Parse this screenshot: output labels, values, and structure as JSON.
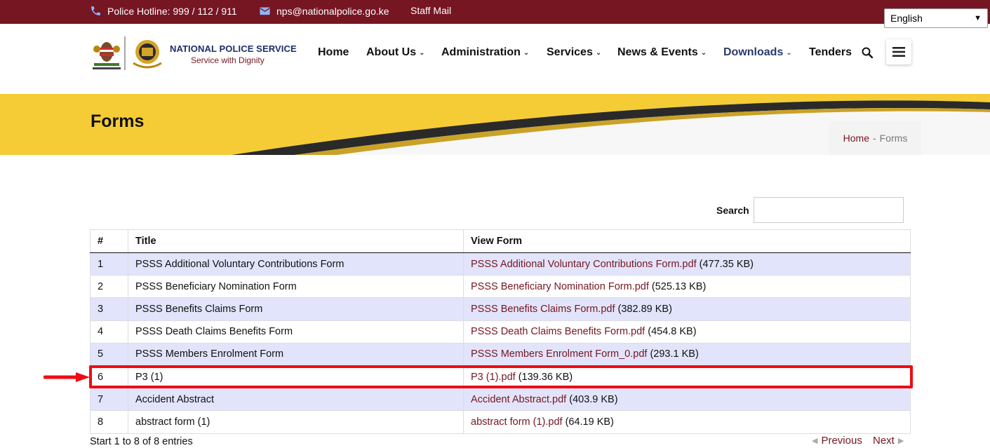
{
  "topbar": {
    "hotline": "Police Hotline: 999 / 112 / 911",
    "email": "nps@nationalpolice.go.ke",
    "staff_mail": "Staff Mail",
    "language": "English"
  },
  "logo": {
    "brand": "NATIONAL POLICE SERVICE",
    "tagline": "Service with Dignity"
  },
  "nav": [
    {
      "label": "Home",
      "dropdown": false
    },
    {
      "label": "About Us",
      "dropdown": true
    },
    {
      "label": "Administration",
      "dropdown": true
    },
    {
      "label": "Services",
      "dropdown": true
    },
    {
      "label": "News & Events",
      "dropdown": true
    },
    {
      "label": "Downloads",
      "dropdown": true,
      "active": true
    },
    {
      "label": "Tenders",
      "dropdown": false
    }
  ],
  "banner": {
    "title": "Forms",
    "breadcrumb_home": "Home",
    "breadcrumb_sep": "-",
    "breadcrumb_current": "Forms"
  },
  "search": {
    "label": "Search",
    "value": ""
  },
  "table": {
    "headers": [
      "#",
      "Title",
      "View Form"
    ],
    "rows": [
      {
        "num": "1",
        "title": "PSSS Additional Voluntary Contributions Form",
        "file": "PSSS Additional Voluntary Contributions Form.pdf",
        "size": " (477.35 KB)"
      },
      {
        "num": "2",
        "title": "PSSS Beneficiary Nomination Form",
        "file": "PSSS Beneficiary Nomination Form.pdf",
        "size": " (525.13 KB)"
      },
      {
        "num": "3",
        "title": "PSSS Benefits Claims Form",
        "file": "PSSS Benefits Claims Form.pdf",
        "size": " (382.89 KB)"
      },
      {
        "num": "4",
        "title": "PSSS Death Claims Benefits Form",
        "file": "PSSS Death Claims Benefits Form.pdf",
        "size": " (454.8 KB)"
      },
      {
        "num": "5",
        "title": "PSSS Members Enrolment Form",
        "file": "PSSS Members Enrolment Form_0.pdf",
        "size": " (293.1 KB)"
      },
      {
        "num": "6",
        "title": "P3 (1)",
        "file": "P3 (1).pdf",
        "size": " (139.36 KB)"
      },
      {
        "num": "7",
        "title": "Accident Abstract",
        "file": "Accident Abstract.pdf",
        "size": " (403.9 KB)"
      },
      {
        "num": "8",
        "title": "abstract form (1)",
        "file": "abstract form (1).pdf",
        "size": " (64.19 KB)"
      }
    ]
  },
  "footer": {
    "info": "Start 1 to 8 of 8 entries",
    "previous": "Previous",
    "next": "Next"
  },
  "colors": {
    "topbar": "#761622",
    "link": "#761622",
    "row_stripe": "#e2e4fb",
    "banner_gold": "#f5cc36",
    "highlight": "#ee0c12"
  }
}
